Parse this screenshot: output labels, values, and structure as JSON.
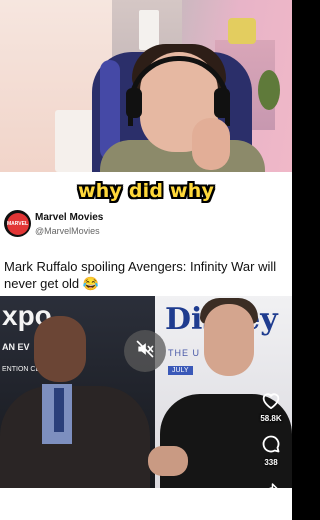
{
  "caption": "why did why",
  "account": {
    "name": "Marvel Movies",
    "handle": "@MarvelMovies",
    "avatar_text": "MARVEL"
  },
  "tweet": {
    "text": "Mark Ruffalo spoiling Avengers: Infinity War will never get old 😂"
  },
  "video": {
    "backdrop_left": "xpo",
    "backdrop_left_sub": "AN EV",
    "backdrop_left_sub2": "ENTION CEN",
    "backdrop_right": "Disney",
    "backdrop_right_sub": "THE U",
    "backdrop_right_date": "JULY",
    "muted": true
  },
  "actions": {
    "likes": "58.8K",
    "comments": "338"
  },
  "icons": {
    "mute": "muted-speaker-icon",
    "like": "heart-icon",
    "comment": "comment-bubble-icon",
    "share": "share-arrow-icon"
  }
}
